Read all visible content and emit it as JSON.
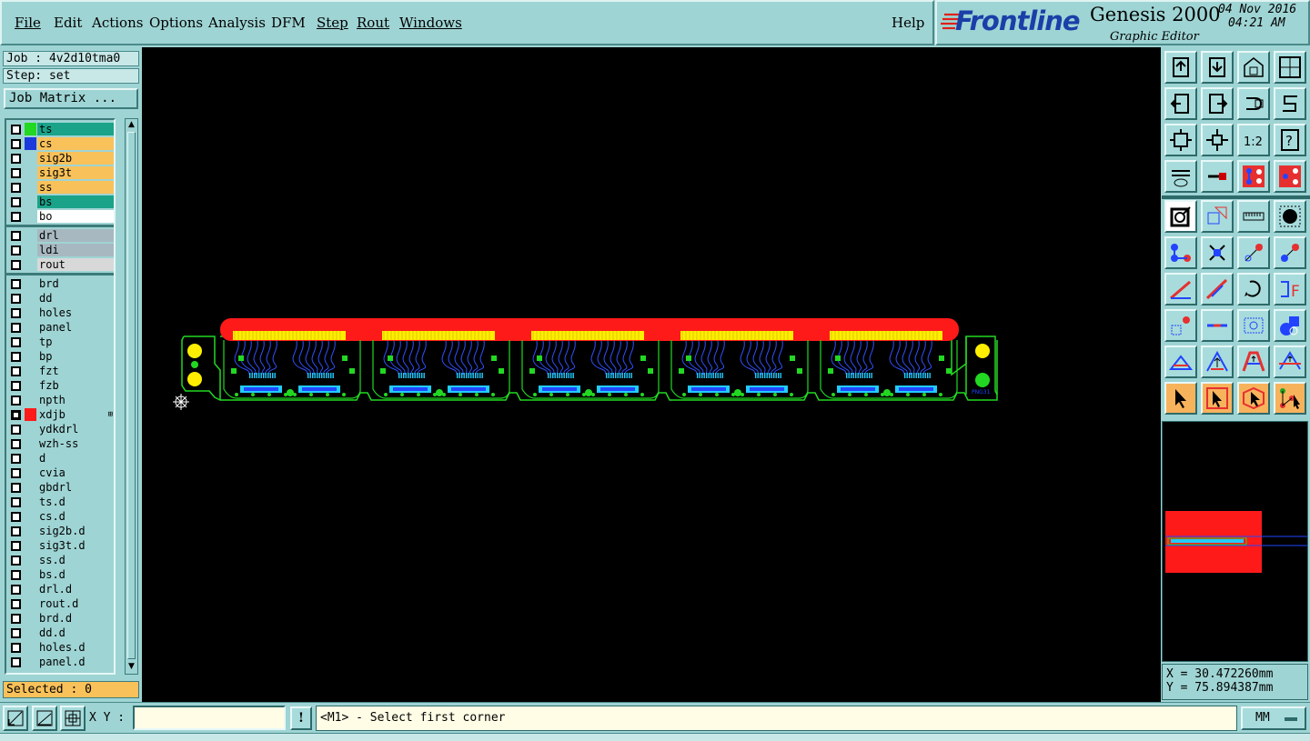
{
  "menu": [
    "File",
    "Edit",
    "Actions",
    "Options",
    "Analysis",
    "DFM",
    "Step",
    "Rout",
    "Windows"
  ],
  "help": "Help",
  "brand": {
    "logo": "Frontline",
    "product": "Genesis 2000",
    "subproduct": "Graphic Editor",
    "date": "04 Nov 2016",
    "time": "04:21 AM"
  },
  "job": {
    "job_label": "Job : 4v2d10tma0",
    "step_label": "Step: set",
    "matrix_button": "Job Matrix ..."
  },
  "layers": [
    {
      "name": "ts",
      "bg": "#1aa389",
      "swatch": "#22d822",
      "checked": false
    },
    {
      "name": "cs",
      "bg": "#f9c15a",
      "swatch": "#1c3adb",
      "checked": false
    },
    {
      "name": "sig2b",
      "bg": "#f9c15a",
      "swatch": "",
      "checked": false
    },
    {
      "name": "sig3t",
      "bg": "#f9c15a",
      "swatch": "",
      "checked": false
    },
    {
      "name": "ss",
      "bg": "#f9c15a",
      "swatch": "",
      "checked": false
    },
    {
      "name": "bs",
      "bg": "#1aa389",
      "swatch": "",
      "checked": false
    },
    {
      "name": "bo",
      "bg": "#ffffff",
      "swatch": "",
      "checked": false
    },
    {
      "name": "drl",
      "bg": "#a8b8c0",
      "swatch": "",
      "checked": false
    },
    {
      "name": "ldi",
      "bg": "#a8b8c0",
      "swatch": "",
      "checked": false
    },
    {
      "name": "rout",
      "bg": "#d8d8d8",
      "swatch": "",
      "checked": false
    },
    {
      "name": "brd",
      "bg": "#9fd4d4",
      "swatch": "",
      "checked": false
    },
    {
      "name": "dd",
      "bg": "#9fd4d4",
      "swatch": "",
      "checked": false
    },
    {
      "name": "holes",
      "bg": "#9fd4d4",
      "swatch": "",
      "checked": false
    },
    {
      "name": "panel",
      "bg": "#9fd4d4",
      "swatch": "",
      "checked": false
    },
    {
      "name": "tp",
      "bg": "#9fd4d4",
      "swatch": "",
      "checked": false
    },
    {
      "name": "bp",
      "bg": "#9fd4d4",
      "swatch": "",
      "checked": false
    },
    {
      "name": "fzt",
      "bg": "#9fd4d4",
      "swatch": "",
      "checked": false
    },
    {
      "name": "fzb",
      "bg": "#9fd4d4",
      "swatch": "",
      "checked": false
    },
    {
      "name": "npth",
      "bg": "#9fd4d4",
      "swatch": "",
      "checked": false
    },
    {
      "name": "xdjb",
      "bg": "#9fd4d4",
      "swatch": "#ff1a1a",
      "checked": true,
      "marked": true
    },
    {
      "name": "ydkdrl",
      "bg": "#9fd4d4",
      "swatch": "",
      "checked": false
    },
    {
      "name": "wzh-ss",
      "bg": "#9fd4d4",
      "swatch": "",
      "checked": false
    },
    {
      "name": "d",
      "bg": "#9fd4d4",
      "swatch": "",
      "checked": false
    },
    {
      "name": "cvia",
      "bg": "#9fd4d4",
      "swatch": "",
      "checked": false
    },
    {
      "name": "gbdrl",
      "bg": "#9fd4d4",
      "swatch": "",
      "checked": false
    },
    {
      "name": "ts.d",
      "bg": "#9fd4d4",
      "swatch": "",
      "checked": false
    },
    {
      "name": "cs.d",
      "bg": "#9fd4d4",
      "swatch": "",
      "checked": false
    },
    {
      "name": "sig2b.d",
      "bg": "#9fd4d4",
      "swatch": "",
      "checked": false
    },
    {
      "name": "sig3t.d",
      "bg": "#9fd4d4",
      "swatch": "",
      "checked": false
    },
    {
      "name": "ss.d",
      "bg": "#9fd4d4",
      "swatch": "",
      "checked": false
    },
    {
      "name": "bs.d",
      "bg": "#9fd4d4",
      "swatch": "",
      "checked": false
    },
    {
      "name": "drl.d",
      "bg": "#9fd4d4",
      "swatch": "",
      "checked": false
    },
    {
      "name": "rout.d",
      "bg": "#9fd4d4",
      "swatch": "",
      "checked": false
    },
    {
      "name": "brd.d",
      "bg": "#9fd4d4",
      "swatch": "",
      "checked": false
    },
    {
      "name": "dd.d",
      "bg": "#9fd4d4",
      "swatch": "",
      "checked": false
    },
    {
      "name": "holes.d",
      "bg": "#9fd4d4",
      "swatch": "",
      "checked": false
    },
    {
      "name": "panel.d",
      "bg": "#9fd4d4",
      "swatch": "",
      "checked": false
    }
  ],
  "selected_label": "Selected : 0",
  "coords": {
    "x": "X = 30.472260mm",
    "y": "Y = 75.894387mm"
  },
  "bottom": {
    "xy_label": "X Y :",
    "xy_value": "",
    "bang": "!",
    "prompt": "<M1> - Select first corner",
    "units": "MM"
  },
  "toolbar_icons": [
    "zoom-home-icon",
    "zoom-in-icon",
    "zoom-out-icon",
    "full-screen-icon",
    "pan-left-icon",
    "pan-right-icon",
    "undo-zoom-icon",
    "redo-zoom-icon",
    "fit-all-icon",
    "fit-profile-icon",
    "one-to-one-icon",
    "help-icon",
    "display-options-icon",
    "measure-icon",
    "layer-compare-icon",
    "layer-stack-icon",
    "snap-icon",
    "select-area-icon",
    "ruler-icon",
    "pad-icon",
    "connect-icon",
    "delete-point-icon",
    "line-add-icon",
    "line-extend-icon",
    "draw-line-icon",
    "draw-arc-icon",
    "rotate-icon",
    "mirror-icon",
    "add-pad-icon",
    "slot-icon",
    "surface-icon",
    "shapes-icon",
    "angle-icon",
    "triangle-icon",
    "outline-icon",
    "span-icon",
    "pointer-icon",
    "select-box-icon",
    "select-poly-icon",
    "net-select-icon"
  ]
}
